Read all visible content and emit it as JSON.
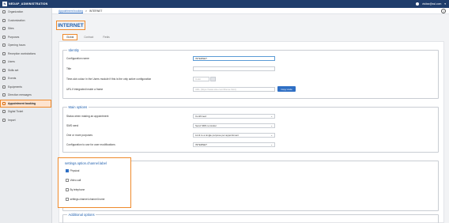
{
  "topbar": {
    "brand": "NEDAP_ADMINISTRATION",
    "user": "visitax@ssl.com",
    "bg_color": "#1f3d6b"
  },
  "sidebar": {
    "items": [
      {
        "label": "Organization",
        "icon": "organization-icon"
      },
      {
        "label": "Customization",
        "icon": "customization-icon"
      },
      {
        "label": "Sites",
        "icon": "sites-icon"
      },
      {
        "label": "Purposes",
        "icon": "purposes-icon"
      },
      {
        "label": "Opening hours",
        "icon": "clock-icon"
      },
      {
        "label": "Reception workstations",
        "icon": "workstation-icon"
      },
      {
        "label": "Users",
        "icon": "users-icon"
      },
      {
        "label": "Skills set",
        "icon": "skills-icon"
      },
      {
        "label": "Events",
        "icon": "events-icon"
      },
      {
        "label": "Equipments",
        "icon": "equipment-icon"
      },
      {
        "label": "Direction messages",
        "icon": "message-icon"
      },
      {
        "label": "Appointment booking",
        "icon": "calendar-icon"
      },
      {
        "label": "Digital Ticket",
        "icon": "ticket-icon"
      },
      {
        "label": "Import",
        "icon": "import-icon"
      }
    ],
    "active_index": 11
  },
  "breadcrumb": {
    "parent": "Appointment booking",
    "separator": ">",
    "current": "INTERNET"
  },
  "page_title": "INTERNET",
  "tabs": [
    {
      "label": "Global"
    },
    {
      "label": "Contract"
    },
    {
      "label": "Fields"
    }
  ],
  "identity": {
    "title": "Identity",
    "fields": [
      {
        "label": "Configuration name",
        "value": "INTERNET",
        "placeholder": ""
      },
      {
        "label": "Title",
        "value": "",
        "placeholder": ""
      },
      {
        "label": "Time-slot colour in the Users module if this is the only active configuration",
        "value": "",
        "placeholder": "Color"
      },
      {
        "label": "URL if integrated inside a frame",
        "value": "",
        "placeholder": "URL (https://www.site.com/iframe.html)"
      }
    ],
    "copy_button": "Copy code"
  },
  "main_options": {
    "title": "Main options",
    "rows": [
      {
        "label": "Status when making an appointment",
        "value": "Confirmed"
      },
      {
        "label": "SMS send",
        "value": "Send SMS reminder"
      },
      {
        "label": "One or more purposes",
        "value": "Limit to a single purpose per appointment"
      },
      {
        "label": "Configuration to use for user modifications",
        "value": "INTERNET"
      }
    ]
  },
  "channel": {
    "title": "settings.option.channel.label",
    "options": [
      {
        "label": "Physical",
        "checked": true
      },
      {
        "label": "Video call",
        "checked": false
      },
      {
        "label": "By telephone",
        "checked": false
      },
      {
        "label": "settings.channel.channel.home",
        "checked": false
      }
    ]
  },
  "additional_options": {
    "title": "Additional options"
  },
  "colors": {
    "highlight": "#ef8a2b",
    "accent": "#2f6fc4",
    "title_blue": "#1f5fae"
  }
}
